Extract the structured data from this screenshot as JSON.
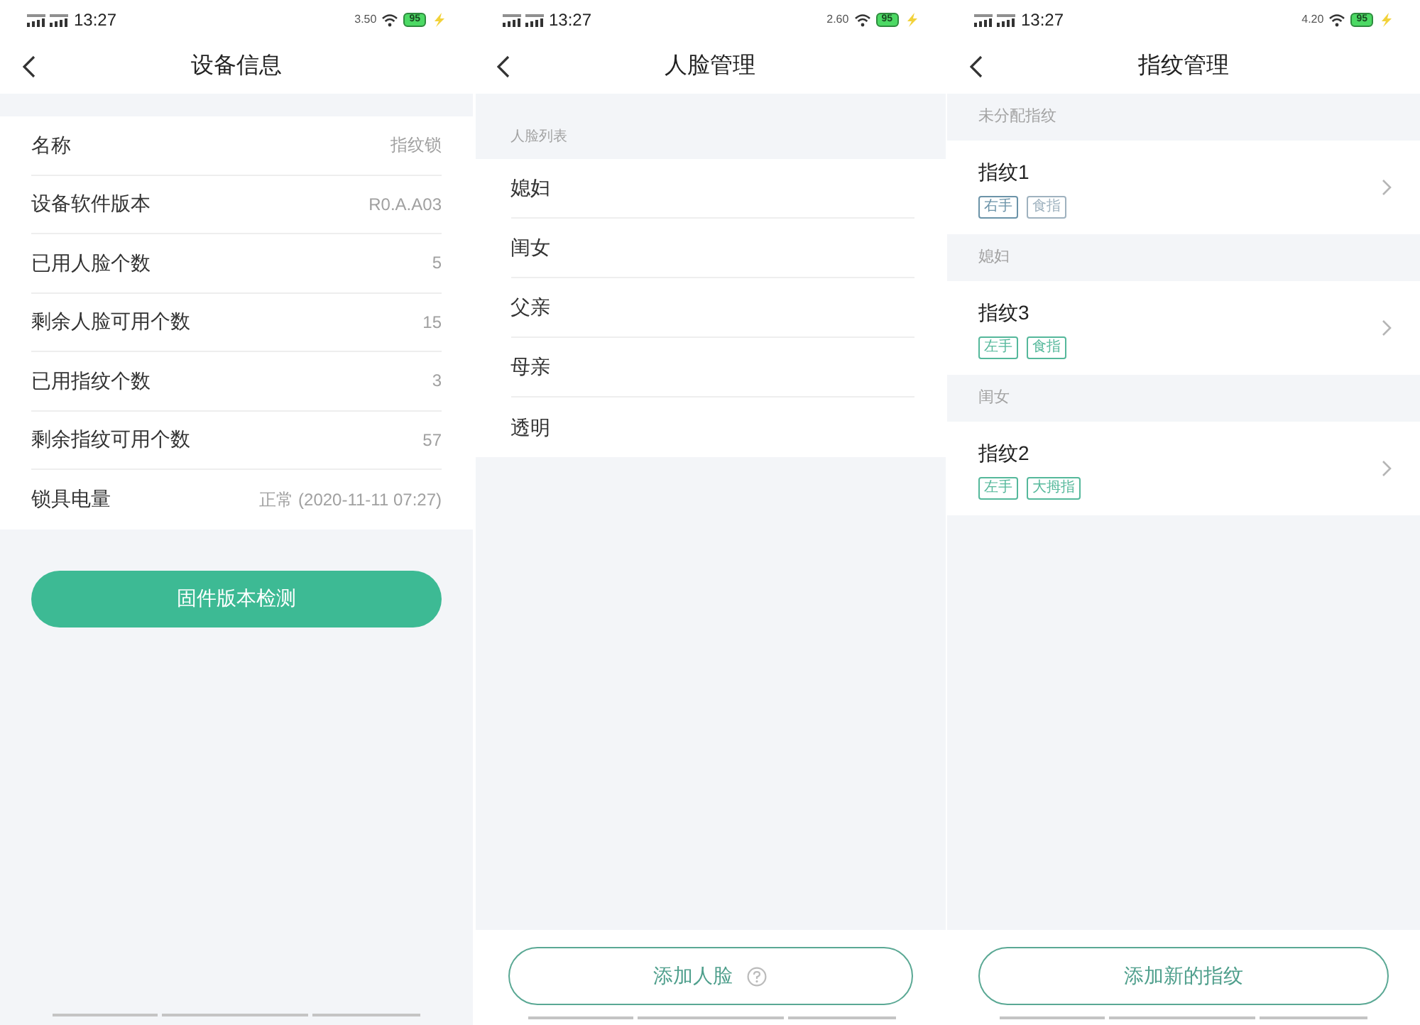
{
  "screens": [
    {
      "kind": "device_info",
      "status_bar": {
        "time": "13:27",
        "net_speed": "3.50",
        "battery": "95"
      },
      "title": "设备信息",
      "rows": [
        {
          "label": "名称",
          "value": "指纹锁"
        },
        {
          "label": "设备软件版本",
          "value": "R0.A.A03"
        },
        {
          "label": "已用人脸个数",
          "value": "5"
        },
        {
          "label": "剩余人脸可用个数",
          "value": "15"
        },
        {
          "label": "已用指纹个数",
          "value": "3"
        },
        {
          "label": "剩余指纹可用个数",
          "value": "57"
        },
        {
          "label": "锁具电量",
          "value": "正常 (2020-11-11 07:27)"
        }
      ],
      "button": "固件版本检测"
    },
    {
      "kind": "face_list",
      "status_bar": {
        "time": "13:27",
        "net_speed": "2.60",
        "battery": "95"
      },
      "title": "人脸管理",
      "section": "人脸列表",
      "items": [
        "媳妇",
        "闺女",
        "父亲",
        "母亲",
        "透明"
      ],
      "button": "添加人脸"
    },
    {
      "kind": "fingerprint_list",
      "status_bar": {
        "time": "13:27",
        "net_speed": "4.20",
        "battery": "95"
      },
      "title": "指纹管理",
      "groups": [
        {
          "header": "未分配指纹",
          "items": [
            {
              "name": "指纹1",
              "tags": [
                {
                  "label": "右手",
                  "color": "#6b93a8"
                },
                {
                  "label": "食指",
                  "color": "#9fb2bf"
                }
              ]
            }
          ]
        },
        {
          "header": "媳妇",
          "items": [
            {
              "name": "指纹3",
              "tags": [
                {
                  "label": "左手",
                  "color": "#55b89b"
                },
                {
                  "label": "食指",
                  "color": "#55b89b"
                }
              ]
            }
          ]
        },
        {
          "header": "闺女",
          "items": [
            {
              "name": "指纹2",
              "tags": [
                {
                  "label": "左手",
                  "color": "#55b89b"
                },
                {
                  "label": "大拇指",
                  "color": "#55b89b"
                }
              ]
            }
          ]
        }
      ],
      "button": "添加新的指纹"
    }
  ]
}
